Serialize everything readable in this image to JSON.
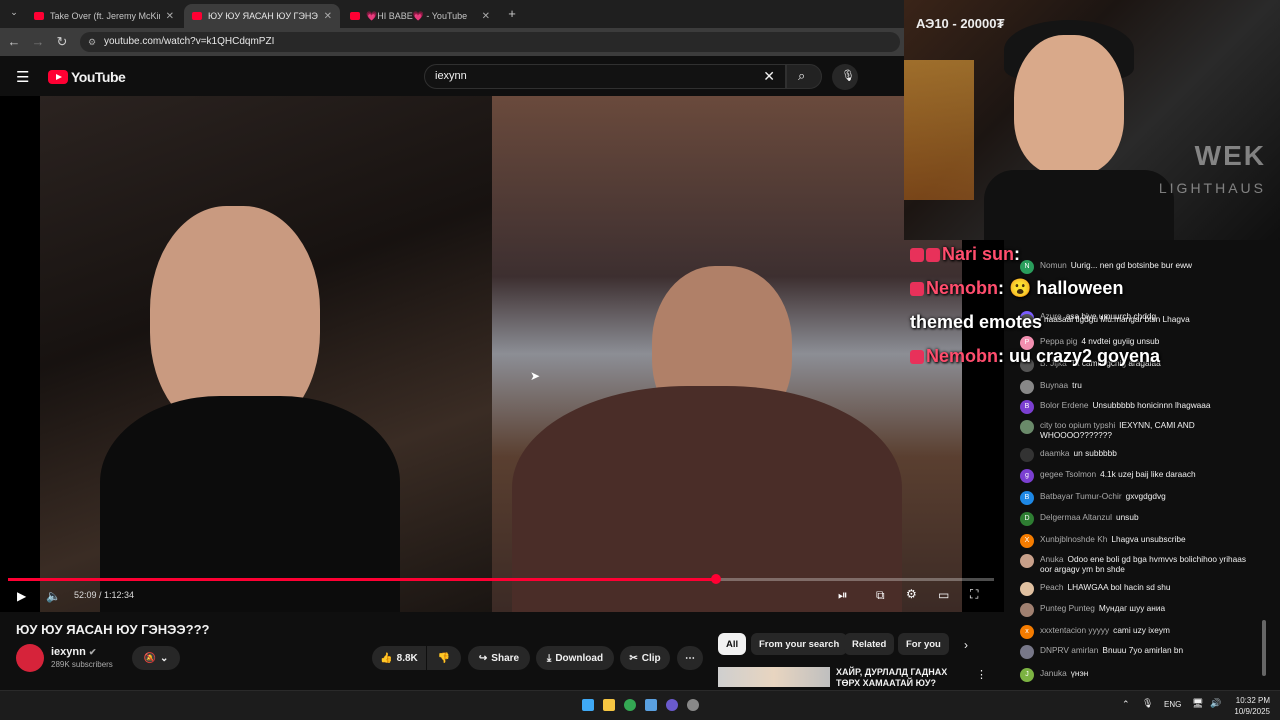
{
  "browser": {
    "tabs": [
      {
        "label": "Take Over (ft. Jeremy McKinnon",
        "active": false
      },
      {
        "label": "ЮУ ЮУ ЯАСАН ЮУ ГЭНЭЭ???",
        "active": true
      },
      {
        "label": "💗HI BABE💗 - YouTube",
        "active": false
      }
    ],
    "url": "youtube.com/watch?v=k1QHCdqmPZI"
  },
  "youtube": {
    "logo_text": "YouTube",
    "search_value": "iexynn"
  },
  "player": {
    "current_time": "52:09",
    "duration": "1:12:34",
    "time_display": "52:09 / 1:12:34",
    "progress_fraction": 0.718
  },
  "video": {
    "title": "ЮУ ЮУ ЯАСАН ЮУ ГЭНЭЭ???",
    "channel": "iexynn",
    "subscribers": "289K subscribers",
    "likes": "8.8K",
    "share_label": "Share",
    "download_label": "Download",
    "clip_label": "Clip"
  },
  "filters": [
    "All",
    "From your search",
    "Related",
    "For you"
  ],
  "recommended": {
    "title": "ХАЙР, ДУРЛАЛД ГАДНАХ ТӨРХ ХАМААТАЙ ЮУ?"
  },
  "stream": {
    "webcam_text": "АЭ10 - 20000₮",
    "brand": "WEK",
    "brand_sub": "LIGHTHAUS",
    "overlay_chat": [
      {
        "name": "Nari sun",
        "text": ""
      },
      {
        "name": "Nemobn",
        "text": "halloween themed emotes"
      },
      {
        "name": "Nemobn",
        "text": "uu crazy2 goyena"
      }
    ],
    "chat": [
      {
        "author": "Nomun",
        "text": "Uurig... nen gd botsinbe bur eww",
        "color": "#2a9d5c",
        "initial": "N"
      },
      {
        "author": "Azure",
        "text": "asa biye umuurch chddg",
        "color": "#7a5cff",
        "initial": "A"
      },
      {
        "author": "",
        "text": "naasaal tlgdgu Mu.mangar btsn Lhagva",
        "color": "#555",
        "initial": ""
      },
      {
        "author": "Peppa pig",
        "text": "4 nvdtei guyiig unsub",
        "color": "#f28fb0",
        "initial": "P"
      },
      {
        "author": "B. Jijka",
        "text": "Ta cami egchig aragalaa",
        "color": "#555",
        "initial": ""
      },
      {
        "author": "Buynaa",
        "text": "tru",
        "color": "#888",
        "initial": ""
      },
      {
        "author": "Bolor Erdene",
        "text": "Unsubbbbb honicinnn lhagwaaa",
        "color": "#7b3fd1",
        "initial": "B"
      },
      {
        "author": "city too opium typshi",
        "text": "IEXYNN, CAMI AND WHOOOO???????",
        "color": "#6a8a6a",
        "initial": ""
      },
      {
        "author": "daamka",
        "text": "un subbbbb",
        "color": "#333",
        "initial": ""
      },
      {
        "author": "gegee Tsolmon",
        "text": "4.1k uzej baij like daraach",
        "color": "#7b3fd1",
        "initial": "g"
      },
      {
        "author": "Batbayar Tumur-Ochir",
        "text": "gxvgdgdvg",
        "color": "#1e88e5",
        "initial": "B"
      },
      {
        "author": "Delgermaa Altanzul",
        "text": "unsub",
        "color": "#2e7d32",
        "initial": "D"
      },
      {
        "author": "Xunbjblnoshde Kh",
        "text": "Lhagva unsubscribe",
        "color": "#f57c00",
        "initial": "X"
      },
      {
        "author": "Anuka",
        "text": "Odoo ene boli gd bga hvmvvs bolichihoo yrihaas oor argagv ym bn shde",
        "color": "#c8a08a",
        "initial": ""
      },
      {
        "author": "Peach",
        "text": "LHAWGAA bol hacin sd shu",
        "color": "#e0c0a0",
        "initial": ""
      },
      {
        "author": "Punteg Punteg",
        "text": "Мундаг шуу аниа",
        "color": "#a08070",
        "initial": ""
      },
      {
        "author": "xxxtentacion yyyyy",
        "text": "cami uzy ixeym",
        "color": "#f57c00",
        "initial": "x"
      },
      {
        "author": "DNPRV amirlan",
        "text": "Bnuuu 7yo amirlan bn",
        "color": "#778",
        "initial": ""
      },
      {
        "author": "Januka",
        "text": "үнэн",
        "color": "#7cb342",
        "initial": "J"
      }
    ]
  },
  "taskbar": {
    "lang": "ENG",
    "time": "10:32 PM",
    "date": "10/9/2025"
  }
}
